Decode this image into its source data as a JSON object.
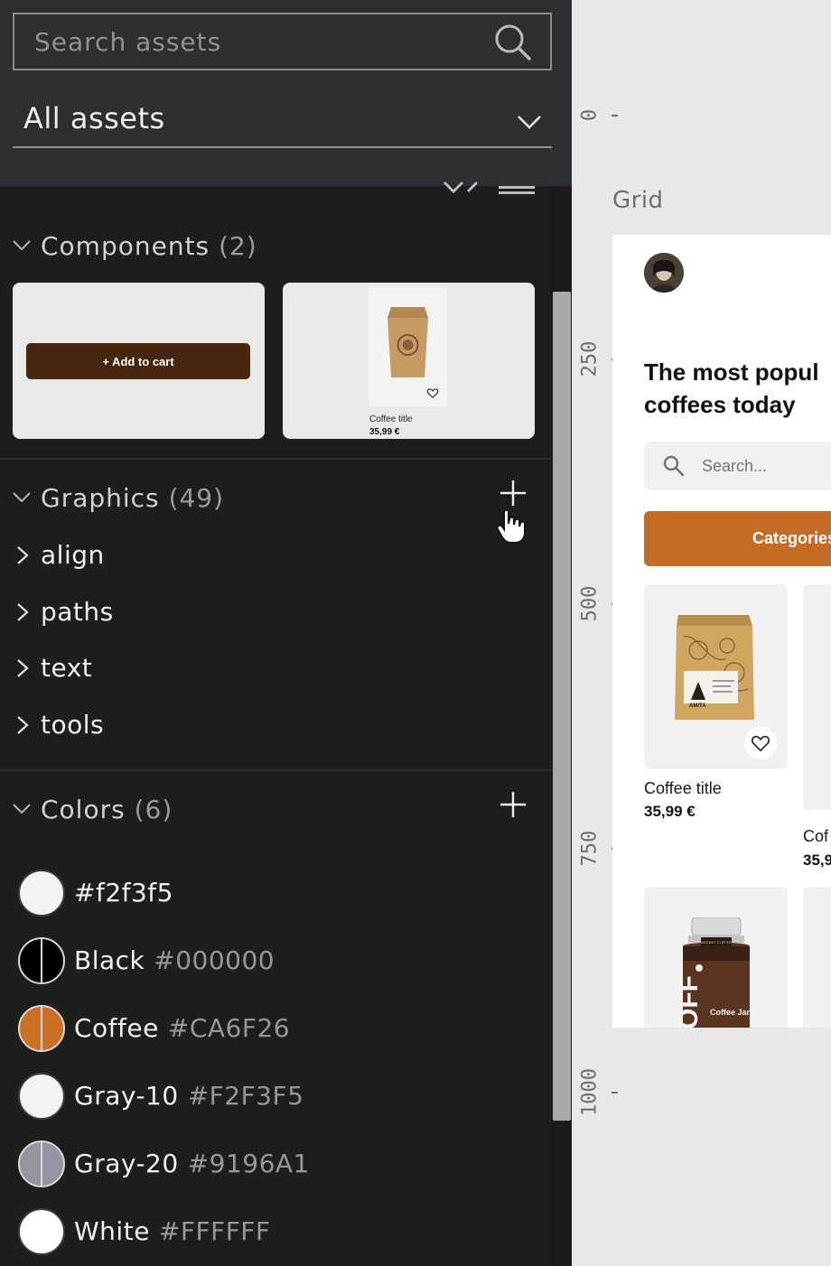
{
  "search": {
    "placeholder": "Search assets"
  },
  "filter": {
    "selected": "All assets"
  },
  "components": {
    "title": "Components",
    "count": "(2)",
    "add_to_cart_label": "+ Add to cart",
    "card_title": "Coffee title",
    "card_price": "35,99 €"
  },
  "graphics": {
    "title": "Graphics",
    "count": "(49)",
    "folders": [
      "align",
      "paths",
      "text",
      "tools"
    ]
  },
  "colors": {
    "title": "Colors",
    "count": "(6)",
    "items": [
      {
        "name": "#f2f3f5",
        "hex": "",
        "color": "#f2f3f5"
      },
      {
        "name": "Black",
        "hex": "#000000",
        "color": "#000000"
      },
      {
        "name": "Coffee",
        "hex": "#CA6F26",
        "color": "#CA6F26"
      },
      {
        "name": "Gray-10",
        "hex": "#F2F3F5",
        "color": "#F2F3F5"
      },
      {
        "name": "Gray-20",
        "hex": "#9196A1",
        "color": "#9196A1"
      },
      {
        "name": "White",
        "hex": "#FFFFFF",
        "color": "#FFFFFF"
      }
    ]
  },
  "canvas": {
    "ruler": [
      "0",
      "250",
      "500",
      "750",
      "1000"
    ],
    "frame_label": "Grid",
    "headline": "The most popul\ncoffees today",
    "search_placeholder": "Search...",
    "categories_label": "Categories",
    "products": [
      {
        "title": "Coffee title",
        "price": "35,99 €"
      },
      {
        "title": "Cof",
        "price": "35,9"
      }
    ],
    "jar_label_top": "INSTANT COFFEE",
    "jar_label": "Coffee Jar Mockup",
    "jar_brand": "OFF",
    "bag_brand": "AMITA"
  }
}
